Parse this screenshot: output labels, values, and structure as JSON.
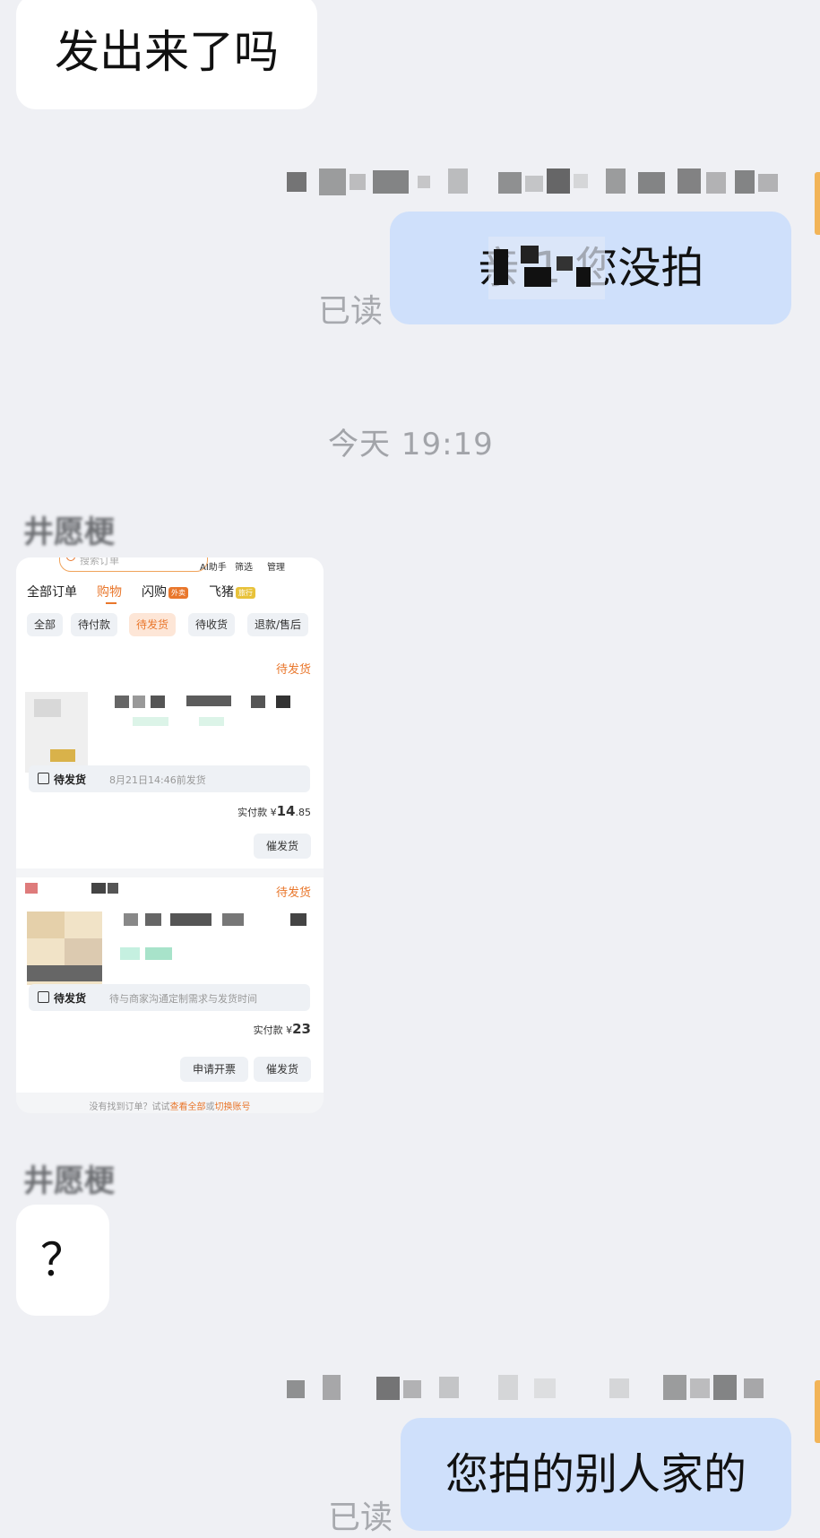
{
  "chat": {
    "msg1": "发出来了吗",
    "reply1": "亲 1 您没拍",
    "read1": "已读",
    "timestamp": "今天 19:19",
    "sender_name_1": "井愿梗",
    "sender_name_2": "井愿梗",
    "msg3": "？",
    "reply2": "您拍的别人家的",
    "read2": "已读"
  },
  "screenshot": {
    "search_placeholder": "搜索订单",
    "top_links": [
      "AI助手",
      "筛选",
      "管理"
    ],
    "main_tabs": [
      {
        "label": "全部订单"
      },
      {
        "label": "购物"
      },
      {
        "label": "闪购",
        "badge": "外卖"
      },
      {
        "label": "飞猪",
        "badge": "旅行"
      }
    ],
    "filter_chips": [
      "全部",
      "待付款",
      "待发货",
      "待收货",
      "退款/售后"
    ],
    "orders": [
      {
        "status": "待发货",
        "ship_label": "待发货",
        "ship_note": "8月21日14:46前发货",
        "paid_label": "实付款",
        "currency": "¥",
        "amount_int": "14",
        "amount_dec": ".85",
        "buttons": [
          "催发货"
        ]
      },
      {
        "status": "待发货",
        "ship_label": "待发货",
        "ship_note": "待与商家沟通定制需求与发货时间",
        "paid_label": "实付款",
        "currency": "¥",
        "amount_int": "23",
        "amount_dec": "",
        "buttons": [
          "申请开票",
          "催发货"
        ]
      }
    ],
    "footer_prefix": "没有找到订单？试试",
    "footer_link1": "查看全部",
    "footer_mid": "或",
    "footer_link2": "切换账号"
  },
  "colors": {
    "background": "#eff0f4",
    "bubble_in": "#ffffff",
    "bubble_out": "#cfe0fb",
    "accent_orange": "#e9772c"
  }
}
